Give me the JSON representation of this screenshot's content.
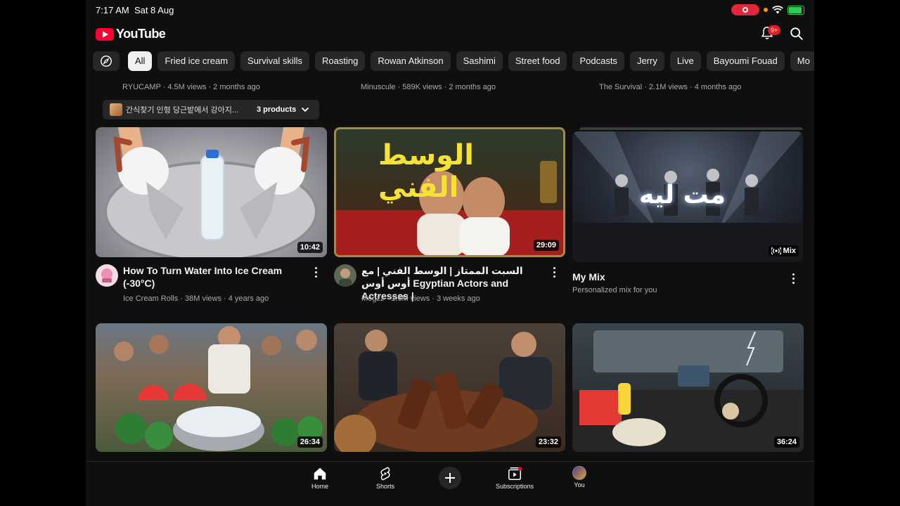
{
  "status": {
    "time": "7:17 AM",
    "date": "Sat 8 Aug"
  },
  "header": {
    "logo_text": "YouTube",
    "notification_badge": "9+"
  },
  "chips": [
    "All",
    "Fried ice cream",
    "Survival skills",
    "Roasting",
    "Rowan Atkinson",
    "Sashimi",
    "Street food",
    "Podcasts",
    "Jerry",
    "Live",
    "Bayoumi Fouad",
    "Mo"
  ],
  "prev_row": [
    "RYUCAMP · 4.5M views · 2 months ago",
    "Minuscule · 589K views · 2 months ago",
    "The Survival · 2.1M views · 4 months ago"
  ],
  "product_pill": {
    "text": "간식찾기 인형 당근밭에서 강아지...",
    "count": "3 products"
  },
  "videos": [
    {
      "title": "How To Turn Water Into Ice Cream (-30°C)",
      "meta": "Ice Cream Rolls · 38M views · 4 years ago",
      "duration": "10:42"
    },
    {
      "title": "السبت الممتاز | الوسط الفني | مع أوس أوس Egyptian Actors and Actresses |",
      "meta": "Mogzz · 1.6M views · 3 weeks ago",
      "duration": "29:09",
      "thumb_text": "الوسط الفني"
    },
    {
      "title": "My Mix",
      "meta": "Personalized mix for you",
      "badge": "Mix",
      "thumb_text": "مت ليه"
    }
  ],
  "row2_durations": [
    "26:34",
    "23:32",
    "36:24"
  ],
  "nav": {
    "home": "Home",
    "shorts": "Shorts",
    "subscriptions": "Subscriptions",
    "you": "You"
  },
  "colors": {
    "background": "#0f0f0f",
    "chip": "#272727",
    "brand_red": "#ff0033",
    "text_secondary": "#aaaaaa"
  }
}
